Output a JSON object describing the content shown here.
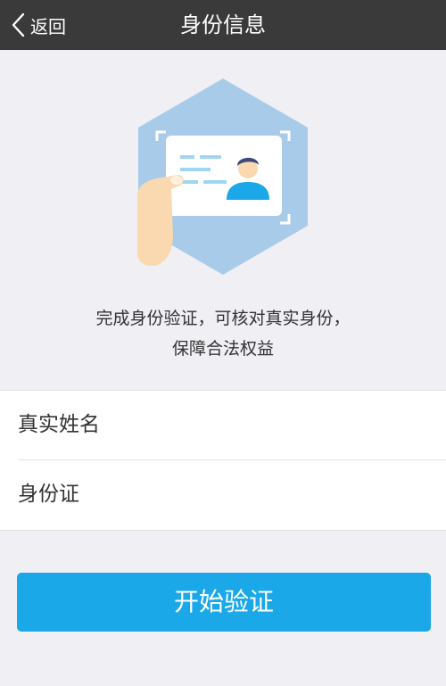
{
  "nav": {
    "back_label": "返回",
    "title": "身份信息"
  },
  "illustration": {
    "icon": "id-card-hand-icon"
  },
  "description": {
    "line1": "完成身份验证，可核对真实身份，",
    "line2": "保障合法权益"
  },
  "form": {
    "real_name_label": "真实姓名",
    "real_name_value": "",
    "id_card_label": "身份证",
    "id_card_value": ""
  },
  "actions": {
    "start_label": "开始验证"
  },
  "colors": {
    "navbar": "#3a3a3a",
    "background": "#efeff4",
    "hexagon": "#a9cbea",
    "accent": "#1aa8e8"
  }
}
